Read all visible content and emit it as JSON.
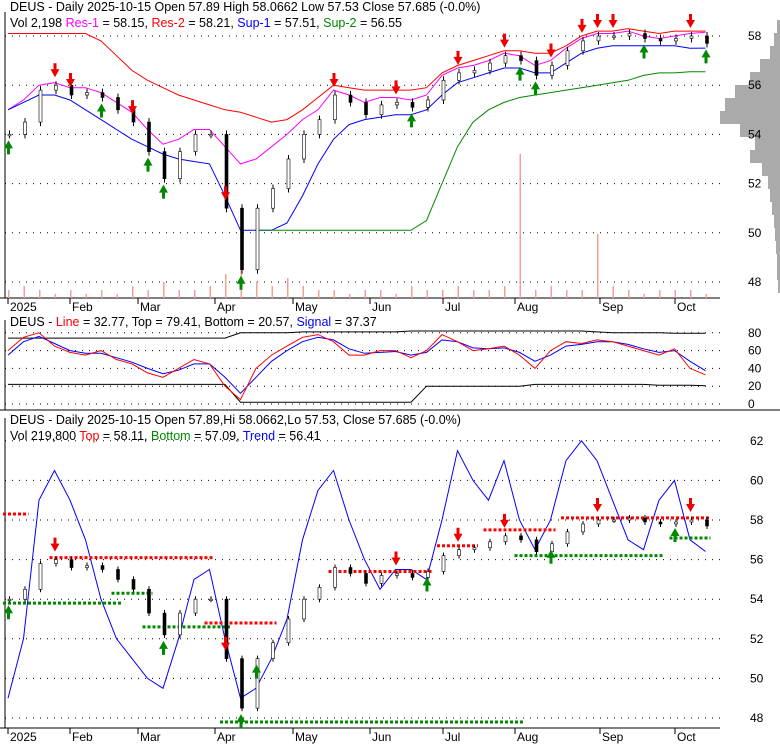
{
  "chart_data": [
    {
      "type": "line",
      "panel": "price",
      "title": "DEUS - Daily 2025-10-15 Open 57.89  High 58.0662  Low 57.53  Close 57.685 (-0.0%)",
      "header": {
        "vol": "Vol 2,198",
        "res1_label": "Res-1",
        "res1_value": " = 58.15,",
        "res2_label": "Res-2",
        "res2_value": " = 58.21,",
        "sup1_label": "Sup-1",
        "sup1_value": " = 57.51,",
        "sup2_label": "Sup-2",
        "sup2_value": " = 56.55"
      },
      "ylim": [
        47.5,
        58.5
      ],
      "yticks": [
        "58",
        "56",
        "54",
        "52",
        "50",
        "48"
      ],
      "yvals": [
        58,
        56,
        54,
        52,
        50,
        48
      ],
      "close": [
        54,
        54.5,
        55.8,
        56,
        55.6,
        55.7,
        55.5,
        55,
        54.5,
        53.3,
        52.2,
        53.3,
        54,
        54,
        51,
        48.5,
        51,
        51.8,
        53,
        54,
        54.6,
        55.6,
        55.3,
        54.8,
        55.2,
        55.3,
        55.1,
        55.4,
        56.2,
        56.5,
        56.6,
        56.9,
        57.2,
        57,
        56.4,
        56.8,
        57.4,
        57.8,
        58,
        58,
        58.1,
        57.9,
        57.8,
        57.9,
        58,
        57.7
      ],
      "res2": [
        58.1,
        58.1,
        58.1,
        58.1,
        58.1,
        58.1,
        57.8,
        57.2,
        56.6,
        56.2,
        55.9,
        55.6,
        55.4,
        55.2,
        55.0,
        54.9,
        54.7,
        54.5,
        54.6,
        55.0,
        55.5,
        56.0,
        55.9,
        55.8,
        55.8,
        55.8,
        55.8,
        55.9,
        56.5,
        56.8,
        57.0,
        57.2,
        57.4,
        57.4,
        57.3,
        57.3,
        57.6,
        58.0,
        58.2,
        58.2,
        58.3,
        58.2,
        58.1,
        58.2,
        58.2,
        58.2
      ],
      "res1": [
        55.0,
        55.4,
        56.0,
        56.1,
        55.9,
        55.9,
        55.7,
        55.3,
        54.9,
        54.2,
        53.6,
        53.8,
        54.2,
        54.2,
        53.5,
        52.8,
        53.0,
        53.5,
        54.0,
        54.6,
        55.0,
        55.8,
        55.6,
        55.3,
        55.5,
        55.5,
        55.4,
        55.6,
        56.4,
        56.7,
        56.8,
        57.0,
        57.3,
        57.2,
        56.8,
        57.0,
        57.5,
        57.9,
        58.1,
        58.1,
        58.2,
        58.0,
        57.9,
        58.0,
        58.1,
        58.15
      ],
      "sup1": [
        55,
        55.3,
        55.6,
        55.6,
        55.4,
        55.0,
        54.6,
        54.2,
        53.8,
        53.5,
        53.2,
        53.0,
        52.9,
        52.8,
        51.5,
        50.1,
        50.1,
        50.1,
        50.4,
        51.5,
        52.8,
        53.8,
        54.4,
        54.6,
        54.7,
        54.8,
        54.8,
        55.0,
        55.6,
        56.1,
        56.3,
        56.5,
        56.7,
        56.7,
        56.5,
        56.5,
        56.9,
        57.3,
        57.5,
        57.6,
        57.6,
        57.6,
        57.6,
        57.6,
        57.5,
        57.51
      ],
      "sup2": [
        null,
        null,
        null,
        null,
        null,
        null,
        null,
        null,
        null,
        null,
        null,
        null,
        null,
        null,
        null,
        null,
        50.1,
        50.1,
        50.1,
        50.1,
        50.1,
        50.1,
        50.1,
        50.1,
        50.1,
        50.1,
        50.1,
        50.5,
        52.0,
        53.5,
        54.5,
        55.0,
        55.3,
        55.5,
        55.6,
        55.7,
        55.8,
        55.9,
        56.0,
        56.1,
        56.2,
        56.4,
        56.5,
        56.5,
        56.55,
        56.55
      ],
      "volume": [
        2,
        3,
        2,
        1,
        2,
        1,
        2,
        1,
        3,
        2,
        4,
        2,
        2,
        3,
        6,
        9,
        4,
        3,
        5,
        3,
        2,
        2,
        1,
        2,
        2,
        1,
        3,
        2,
        2,
        3,
        2,
        2,
        3,
        36,
        2,
        3,
        2,
        2,
        16,
        3,
        2,
        1,
        2,
        2,
        2,
        1
      ],
      "volume_profile": [
        3,
        6,
        10,
        20,
        30,
        45,
        55,
        60,
        40,
        25,
        30,
        18,
        12,
        10,
        8,
        6,
        5,
        4,
        3,
        3,
        2
      ],
      "sell_arrows": [
        3,
        4,
        8,
        14,
        21,
        25,
        29,
        32,
        35,
        37,
        38,
        39,
        44
      ],
      "buy_arrows": [
        0,
        6,
        9,
        10,
        15,
        26,
        33,
        34,
        41,
        45
      ]
    },
    {
      "type": "line",
      "panel": "oscillator",
      "header": {
        "name": "DEUS - ",
        "line_label": "Line",
        "line_value": " = 32.77, Top = 79.41, Bottom = 20.57, ",
        "signal_label": "Signal",
        "signal_value": " = 37.37"
      },
      "ylim": [
        0,
        90
      ],
      "yticks": [
        "80",
        "60",
        "40",
        "20",
        "0"
      ],
      "yvals": [
        80,
        60,
        40,
        20,
        0
      ],
      "line": [
        60,
        75,
        80,
        65,
        58,
        55,
        60,
        50,
        45,
        35,
        30,
        40,
        50,
        45,
        20,
        5,
        40,
        55,
        65,
        75,
        78,
        70,
        55,
        55,
        60,
        60,
        52,
        60,
        78,
        70,
        60,
        62,
        65,
        55,
        40,
        60,
        70,
        68,
        72,
        70,
        65,
        60,
        55,
        62,
        40,
        32.77
      ],
      "signal": [
        55,
        70,
        76,
        68,
        60,
        57,
        57,
        52,
        47,
        40,
        34,
        38,
        45,
        45,
        30,
        12,
        30,
        48,
        60,
        70,
        75,
        72,
        62,
        57,
        58,
        59,
        55,
        58,
        72,
        70,
        63,
        62,
        63,
        58,
        48,
        55,
        65,
        67,
        70,
        70,
        67,
        62,
        58,
        60,
        48,
        37.37
      ],
      "top": [
        74,
        74,
        74,
        74,
        74,
        74,
        74,
        74,
        74,
        74,
        74,
        74,
        74,
        74,
        74,
        80,
        80,
        80,
        80,
        81,
        81,
        81,
        81,
        81,
        81,
        81,
        82,
        82,
        82,
        82,
        82,
        82,
        82,
        82,
        82,
        82,
        82,
        82,
        81,
        80,
        80,
        80,
        80,
        79.4,
        79.4,
        79.41
      ],
      "bottom": [
        22,
        22,
        22,
        22,
        22,
        22,
        22,
        22,
        22,
        22,
        22,
        22,
        22,
        22,
        22,
        2,
        2,
        2,
        2,
        2,
        2,
        2,
        2,
        2,
        2,
        2,
        2,
        20,
        20,
        20,
        20,
        20,
        20,
        20,
        22,
        22,
        22,
        22,
        22,
        22,
        22,
        22,
        21,
        21,
        21,
        20.57
      ]
    },
    {
      "type": "line",
      "panel": "trend",
      "header": {
        "title": "DEUS - Daily 2025-10-15 Open 57.89,Hi 58.0662,Lo 57.53, Close 57.685 (-0.0%)",
        "vol": "Vol 219,800 ",
        "top_label": "Top",
        "top_value": " = 58.11, ",
        "bottom_label": "Bottom",
        "bottom_value": " = 57.09, ",
        "trend_label": "Trend",
        "trend_value": " = 56.41"
      },
      "ylim": [
        47.5,
        63
      ],
      "yticks": [
        "62",
        "60",
        "58",
        "56",
        "54",
        "52",
        "50",
        "48"
      ],
      "yvals": [
        62,
        60,
        58,
        56,
        54,
        52,
        50,
        48
      ],
      "trend": [
        49,
        52,
        59,
        60.5,
        59,
        57,
        54,
        52,
        51,
        50,
        49.5,
        52,
        55,
        55.5,
        52,
        49,
        49.5,
        51,
        53,
        57,
        59.5,
        60.5,
        58,
        56,
        54.5,
        55.5,
        55.5,
        55,
        58,
        61.5,
        60,
        59,
        61,
        58,
        56.5,
        58,
        61,
        62,
        61,
        59,
        57,
        56.5,
        59,
        60,
        57,
        56.41
      ],
      "top_levels": [
        [
          0,
          1,
          58.3
        ],
        [
          3,
          13,
          56.1
        ],
        [
          13,
          17,
          52.8
        ],
        [
          21,
          27,
          55.4
        ],
        [
          28,
          30,
          56.7
        ],
        [
          31,
          35,
          57.5
        ],
        [
          36,
          45,
          58.11
        ]
      ],
      "bottom_levels": [
        [
          0,
          7,
          53.8
        ],
        [
          7,
          9,
          54.3
        ],
        [
          9,
          14,
          52.6
        ],
        [
          14,
          33,
          47.8
        ],
        [
          33,
          42,
          56.2
        ],
        [
          43,
          45,
          57.09
        ]
      ],
      "sell_arrows": [
        3,
        14,
        25,
        29,
        32,
        38,
        44
      ],
      "buy_arrows": [
        0,
        10,
        15,
        16,
        27,
        35,
        43
      ]
    }
  ],
  "x_axis": {
    "months": [
      "2025",
      "Feb",
      "Mar",
      "Apr",
      "May",
      "Jun",
      "Jul",
      "Aug",
      "Sep",
      "Oct"
    ]
  }
}
